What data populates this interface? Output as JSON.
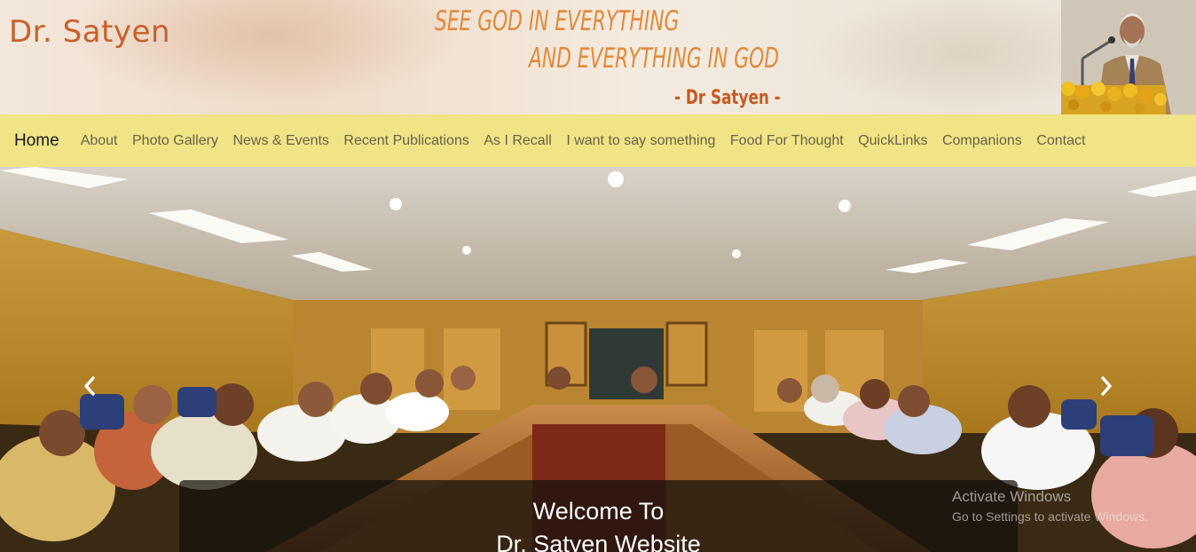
{
  "header": {
    "site_title": "Dr. Satyen",
    "motto_line1": "SEE GOD IN EVERYTHING",
    "motto_line2": "AND EVERYTHING IN GOD",
    "motto_signature": "- Dr Satyen -"
  },
  "nav": {
    "home": "Home",
    "items": [
      "About",
      "Photo Gallery",
      "News & Events",
      "Recent Publications",
      "As I Recall",
      "I want to say something",
      "Food For Thought",
      "QuickLinks",
      "Companions",
      "Contact"
    ]
  },
  "carousel": {
    "caption_line1": "Welcome To",
    "caption_line2": "Dr. Satyen Website",
    "prev_icon": "chevron-left-icon",
    "next_icon": "chevron-right-icon"
  },
  "watermark": {
    "title": "Activate Windows",
    "subtitle": "Go to Settings to activate Windows."
  },
  "colors": {
    "title_orange": "#c8602a",
    "motto_orange": "#e3893a",
    "nav_background": "#f0e486",
    "nav_text": "#6b6248"
  }
}
